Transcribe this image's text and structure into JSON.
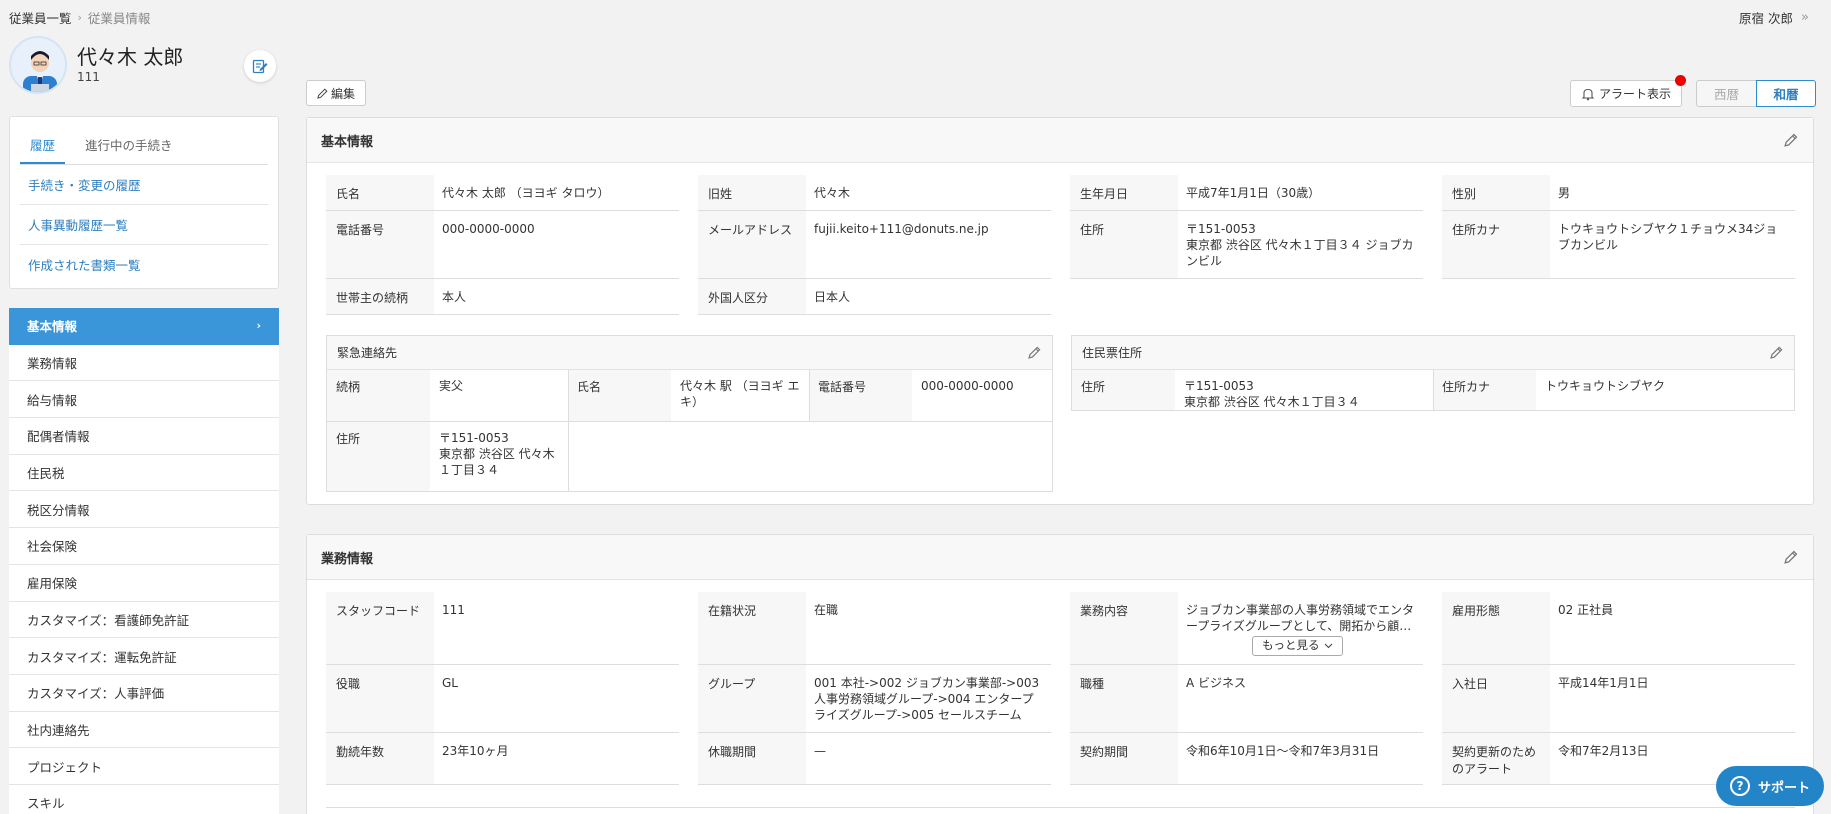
{
  "breadcrumb": {
    "parent": "従業員一覧",
    "separator": "›",
    "current": "従業員情報"
  },
  "user_menu": {
    "name": "原宿 次郎",
    "collapse_icon": "»"
  },
  "profile": {
    "name": "代々木 太郎",
    "id": "111"
  },
  "side": {
    "tabs": [
      {
        "label": "履歴"
      },
      {
        "label": "進行中の手続き"
      }
    ],
    "links": [
      {
        "label": "手続き・変更の履歴"
      },
      {
        "label": "人事異動履歴一覧"
      },
      {
        "label": "作成された書類一覧"
      }
    ]
  },
  "nav": {
    "items": [
      {
        "label": "基本情報"
      },
      {
        "label": "業務情報"
      },
      {
        "label": "給与情報"
      },
      {
        "label": "配偶者情報"
      },
      {
        "label": "住民税"
      },
      {
        "label": "税区分情報"
      },
      {
        "label": "社会保険"
      },
      {
        "label": "雇用保険"
      },
      {
        "label": "カスタマイズ：看護師免許証"
      },
      {
        "label": "カスタマイズ：運転免許証"
      },
      {
        "label": "カスタマイズ：人事評価"
      },
      {
        "label": "社内連絡先"
      },
      {
        "label": "プロジェクト"
      },
      {
        "label": "スキル"
      }
    ],
    "arrow": "›"
  },
  "toolbar": {
    "edit_label": "編集",
    "alert_label": "アラート表示",
    "era_western": "西暦",
    "era_japanese": "和暦"
  },
  "basic": {
    "title": "基本情報",
    "fields": [
      {
        "label": "氏名",
        "value": "代々木 太郎 （ヨヨギ タロウ）"
      },
      {
        "label": "旧姓",
        "value": "代々木"
      },
      {
        "label": "生年月日",
        "value": "平成7年1月1日（30歳）"
      },
      {
        "label": "性別",
        "value": "男"
      },
      {
        "label": "電話番号",
        "value": "000-0000-0000"
      },
      {
        "label": "メールアドレス",
        "value": "fujii.keito+111@donuts.ne.jp"
      },
      {
        "label": "住所",
        "value": "〒151-0053\n東京都 渋谷区 代々木１丁目３４ ジョブカンビル"
      },
      {
        "label": "住所カナ",
        "value": "トウキョウトシブヤク１チョウメ34ジョブカンビル"
      },
      {
        "label": "世帯主の続柄",
        "value": "本人"
      },
      {
        "label": "外国人区分",
        "value": "日本人"
      }
    ],
    "emergency": {
      "title": "緊急連絡先",
      "relation_label": "続柄",
      "relation": "実父",
      "name_label": "氏名",
      "name": "代々木 駅 （ヨヨギ エキ）",
      "phone_label": "電話番号",
      "phone": "000-0000-0000",
      "address_label": "住所",
      "address": "〒151-0053\n東京都 渋谷区 代々木１丁目３４"
    },
    "resident": {
      "title": "住民票住所",
      "address_label": "住所",
      "address": "〒151-0053\n東京都 渋谷区 代々木１丁目３４",
      "kana_label": "住所カナ",
      "kana": "トウキョウトシブヤク"
    }
  },
  "business": {
    "title": "業務情報",
    "fields": [
      {
        "label": "スタッフコード",
        "value": "111"
      },
      {
        "label": "在籍状況",
        "value": "在職"
      },
      {
        "label": "業務内容",
        "value": "ジョブカン事業部の人事労務領域でエンタープライズグループとして、開拓から顧…"
      },
      {
        "label": "雇用形態",
        "value": "02 正社員"
      },
      {
        "label": "役職",
        "value": "GL"
      },
      {
        "label": "グループ",
        "value": "001 本社->002 ジョブカン事業部->003 人事労務領域グループ->004 エンタープライズグループ->005 セールスチーム"
      },
      {
        "label": "職種",
        "value": "A ビジネス"
      },
      {
        "label": "入社日",
        "value": "平成14年1月1日"
      },
      {
        "label": "勤続年数",
        "value": "23年10ヶ月"
      },
      {
        "label": "休職期間",
        "value": "—"
      },
      {
        "label": "契約期間",
        "value": "令和6年10月1日～令和7年3月31日"
      },
      {
        "label": "契約更新のためのアラート",
        "value": "令和7年2月13日"
      }
    ],
    "more_label": "もっと見る"
  },
  "support": {
    "label": "サポート",
    "icon": "?"
  }
}
